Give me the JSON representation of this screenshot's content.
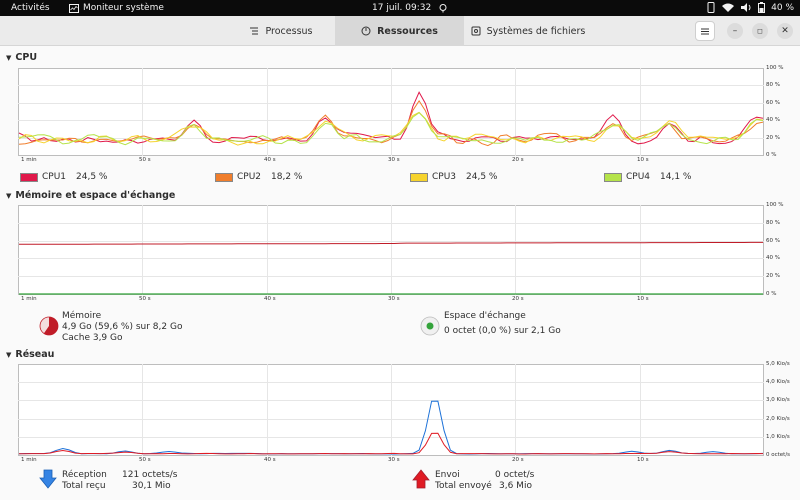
{
  "topbar": {
    "activities": "Activités",
    "app_name": "Moniteur système",
    "clock": "17 juil.  09:32",
    "battery": "40 %"
  },
  "tabs": [
    {
      "label": "Processus",
      "icon": "list-icon",
      "active": false
    },
    {
      "label": "Ressources",
      "icon": "gauge-icon",
      "active": true
    },
    {
      "label": "Systèmes de fichiers",
      "icon": "disk-icon",
      "active": false
    }
  ],
  "x_ticks": [
    "1 min",
    "50 s",
    "40 s",
    "30 s",
    "20 s",
    "10 s"
  ],
  "cpu": {
    "title": "CPU",
    "y_ticks": [
      "100 %",
      "80 %",
      "60 %",
      "40 %",
      "20 %",
      "0 %"
    ],
    "cores": [
      {
        "name": "CPU1",
        "value": "24,5 %",
        "color": "#e0194a"
      },
      {
        "name": "CPU2",
        "value": "18,2 %",
        "color": "#f07e2c"
      },
      {
        "name": "CPU3",
        "value": "24,5 %",
        "color": "#f6d32d"
      },
      {
        "name": "CPU4",
        "value": "14,1 %",
        "color": "#b5e34a"
      }
    ]
  },
  "memory": {
    "title": "Mémoire et espace d'échange",
    "y_ticks": [
      "100 %",
      "80 %",
      "60 %",
      "40 %",
      "20 %",
      "0 %"
    ],
    "ram_label": "Mémoire",
    "ram_usage": "4,9 Go (59,6 %) sur 8,2 Go",
    "ram_cache": "Cache 3,9 Go",
    "ram_fraction": 0.596,
    "ram_color": "#c01c28",
    "swap_label": "Espace d'échange",
    "swap_usage": "0 octet (0,0 %) sur 2,1 Go",
    "swap_fraction": 0.0,
    "swap_color": "#33a33a"
  },
  "network": {
    "title": "Réseau",
    "y_ticks": [
      "5,0 Kio/s",
      "4,0 Kio/s",
      "3,0 Kio/s",
      "2,0 Kio/s",
      "1,0 Kio/s",
      "0 octet/s"
    ],
    "rx_label": "Réception",
    "rx_rate": "121 octets/s",
    "rx_total_label": "Total reçu",
    "rx_total": "30,1 Mio",
    "rx_color": "#1c71d8",
    "tx_label": "Envoi",
    "tx_rate": "0 octet/s",
    "tx_total_label": "Total envoyé",
    "tx_total": "3,6 Mio",
    "tx_color": "#e01b24"
  }
}
